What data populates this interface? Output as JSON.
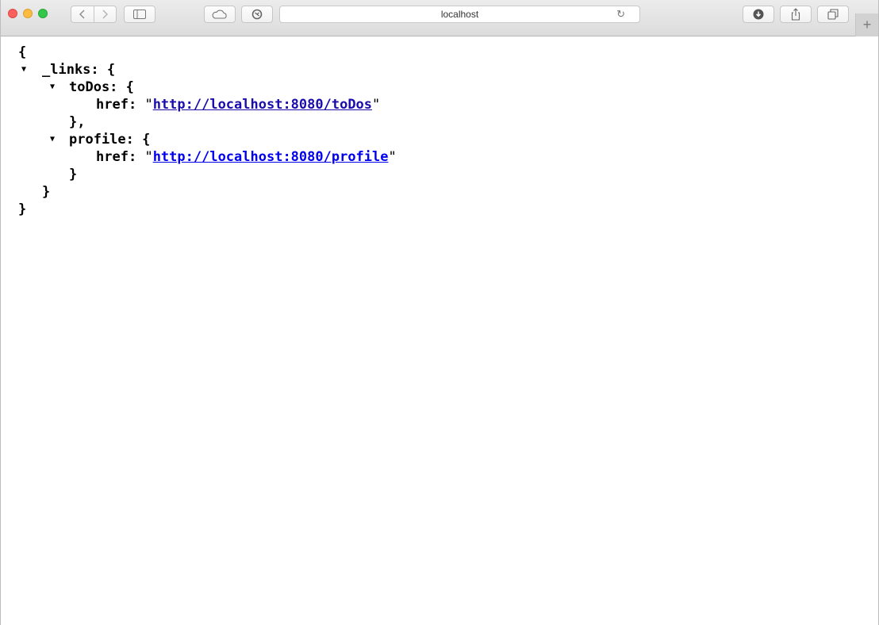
{
  "browser": {
    "url": "localhost"
  },
  "json_view": {
    "open_root": "{",
    "links_key": "_links: {",
    "todos_key": "toDos: {",
    "todos_href_key": "href:",
    "todos_href_value": "http://localhost:8080/toDos",
    "todos_close": "},",
    "profile_key": "profile: {",
    "profile_href_key": "href:",
    "profile_href_value": "http://localhost:8080/profile",
    "profile_close": "}",
    "links_close": "}",
    "close_root": "}"
  },
  "colors": {
    "visited_link": "#1a0dab",
    "link": "#0000ee"
  }
}
